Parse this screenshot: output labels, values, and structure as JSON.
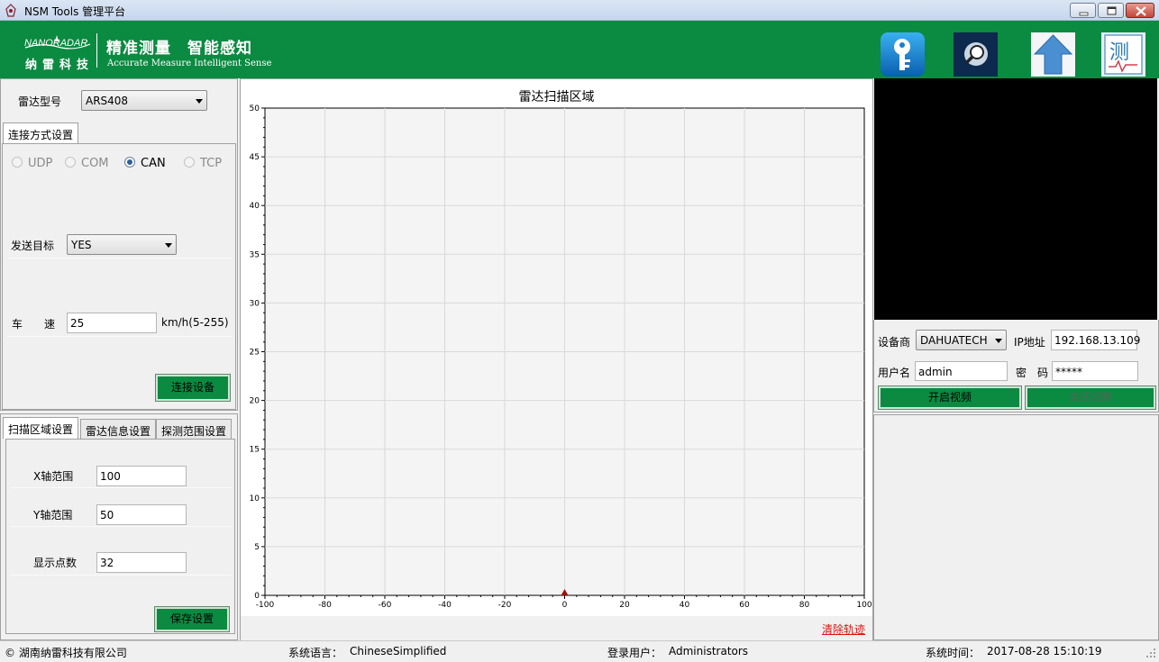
{
  "window": {
    "title": "NSM Tools 管理平台"
  },
  "header": {
    "logo_en": "NANORADAR",
    "logo_cn": "纳雷科技",
    "slogan_cn": "精准测量　智能感知",
    "slogan_en": "Accurate Measure  Intelligent Sense",
    "brand_color": "#0b8a41",
    "tool_icons": [
      "key-icon",
      "search-magnifier-icon",
      "upload-arrow-icon",
      "measure-report-icon"
    ]
  },
  "radar": {
    "model_label": "雷达型号",
    "model_value": "ARS408"
  },
  "connection": {
    "tab_label": "连接方式设置",
    "options": [
      "UDP",
      "COM",
      "CAN",
      "TCP"
    ],
    "selected": "CAN",
    "send_target_label": "发送目标",
    "send_target_value": "YES",
    "speed_label_1": "车",
    "speed_label_2": "速",
    "speed_value": "25",
    "speed_unit": "km/h(5-255)",
    "connect_button": "连接设备"
  },
  "settings": {
    "tabs": [
      "扫描区域设置",
      "雷达信息设置",
      "探测范围设置"
    ],
    "x_range_label": "X轴范围",
    "x_range_value": "100",
    "y_range_label": "Y轴范围",
    "y_range_value": "50",
    "points_label": "显示点数",
    "points_value": "32",
    "save_button": "保存设置"
  },
  "chart_data": {
    "type": "scatter",
    "title": "雷达扫描区域",
    "xlabel": "",
    "ylabel": "",
    "xlim": [
      -100,
      100
    ],
    "ylim": [
      0,
      50
    ],
    "x_ticks": [
      -100,
      -80,
      -60,
      -40,
      -20,
      0,
      20,
      40,
      60,
      80,
      100
    ],
    "y_ticks": [
      0,
      5,
      10,
      15,
      20,
      25,
      30,
      35,
      40,
      45,
      50
    ],
    "grid": true,
    "points": [],
    "radar_marker": {
      "x": 0,
      "y": 0,
      "color": "#a01010"
    }
  },
  "chart_footer": {
    "clear_link": "清除轨迹"
  },
  "video": {
    "vendor_label": "设备商",
    "vendor_value": "DAHUATECH",
    "ip_label": "IP地址",
    "ip_value": "192.168.13.109",
    "user_label": "用户名",
    "user_value": "admin",
    "password_label": "密　码",
    "password_value": "*****",
    "open_button": "开启视频",
    "close_button": "关闭视频"
  },
  "status": {
    "company": "© 湖南纳雷科技有限公司",
    "language_label": "系统语言：",
    "language_value": "ChineseSimplified",
    "user_label": "登录用户：",
    "user_value": "Administrators",
    "time_label": "系统时间：",
    "time_value": "2017-08-28 15:10:19"
  }
}
